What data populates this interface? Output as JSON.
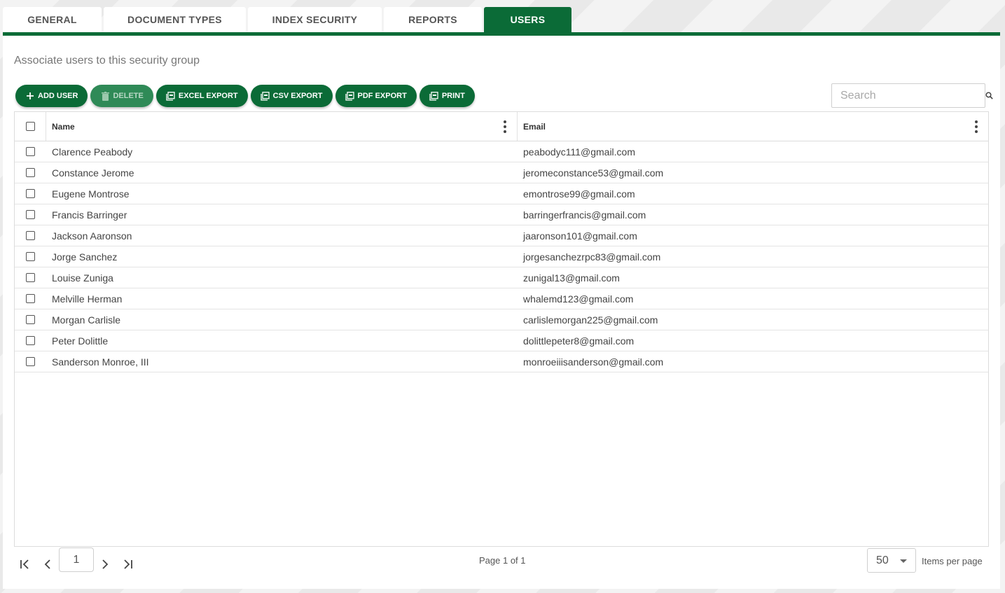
{
  "tabs": [
    {
      "label": "GENERAL",
      "active": false
    },
    {
      "label": "DOCUMENT TYPES",
      "active": false
    },
    {
      "label": "INDEX SECURITY",
      "active": false
    },
    {
      "label": "REPORTS",
      "active": false
    },
    {
      "label": "USERS",
      "active": true
    }
  ],
  "subtitle": "Associate users to this security group",
  "toolbar": {
    "add_user": "ADD USER",
    "delete": "DELETE",
    "excel_export": "EXCEL EXPORT",
    "csv_export": "CSV EXPORT",
    "pdf_export": "PDF EXPORT",
    "print": "PRINT"
  },
  "search": {
    "placeholder": "Search",
    "value": ""
  },
  "grid": {
    "columns": {
      "name": "Name",
      "email": "Email"
    },
    "rows": [
      {
        "name": "Clarence Peabody",
        "email": "peabodyc111@gmail.com"
      },
      {
        "name": "Constance Jerome",
        "email": "jeromeconstance53@gmail.com"
      },
      {
        "name": "Eugene Montrose",
        "email": "emontrose99@gmail.com"
      },
      {
        "name": "Francis Barringer",
        "email": "barringerfrancis@gmail.com"
      },
      {
        "name": "Jackson Aaronson",
        "email": "jaaronson101@gmail.com"
      },
      {
        "name": "Jorge Sanchez",
        "email": "jorgesanchezrpc83@gmail.com"
      },
      {
        "name": "Louise Zuniga",
        "email": "zunigal13@gmail.com"
      },
      {
        "name": "Melville Herman",
        "email": "whalemd123@gmail.com"
      },
      {
        "name": "Morgan Carlisle",
        "email": "carlislemorgan225@gmail.com"
      },
      {
        "name": "Peter Dolittle",
        "email": "dolittlepeter8@gmail.com"
      },
      {
        "name": "Sanderson Monroe, III",
        "email": "monroeiiisanderson@gmail.com"
      }
    ]
  },
  "pager": {
    "current_page": "1",
    "info": "Page 1 of 1",
    "page_size": "50",
    "items_per_page_label": "Items per page"
  },
  "colors": {
    "accent": "#0b6b37"
  }
}
